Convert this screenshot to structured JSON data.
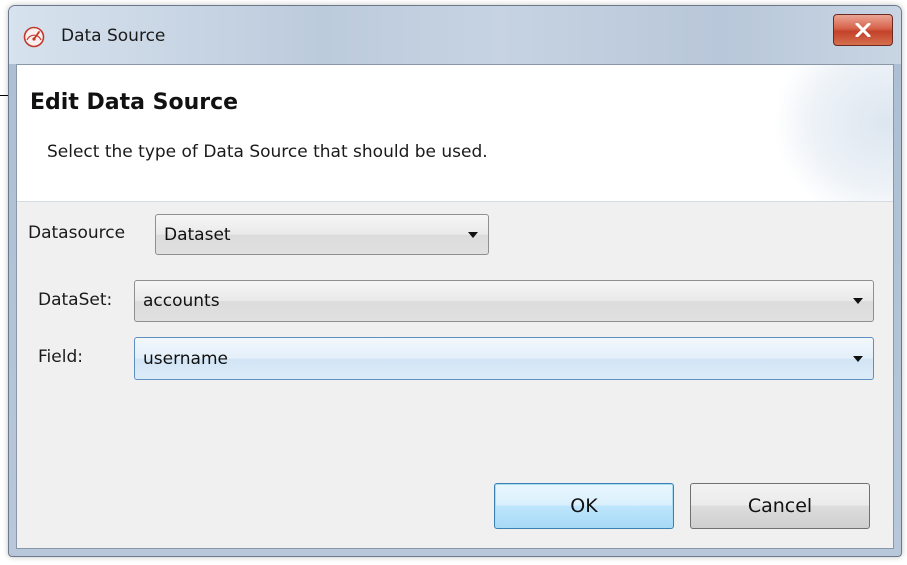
{
  "window": {
    "title": "Data Source",
    "close_label": "x"
  },
  "header": {
    "title": "Edit Data Source",
    "description": "Select the type of Data Source that should be used."
  },
  "form": {
    "datasource": {
      "label": "Datasource",
      "value": "Dataset"
    },
    "dataset": {
      "label": "DataSet:",
      "value": "accounts"
    },
    "field": {
      "label": "Field:",
      "value": "username"
    }
  },
  "buttons": {
    "ok": "OK",
    "cancel": "Cancel"
  },
  "icons": {
    "app": "gauge-icon",
    "close": "close-icon",
    "dropdown": "chevron-down-icon"
  },
  "colors": {
    "close_button": "#c2412a",
    "default_button_border": "#3c7fb1",
    "focused_combo_border": "#5f8fbf"
  }
}
